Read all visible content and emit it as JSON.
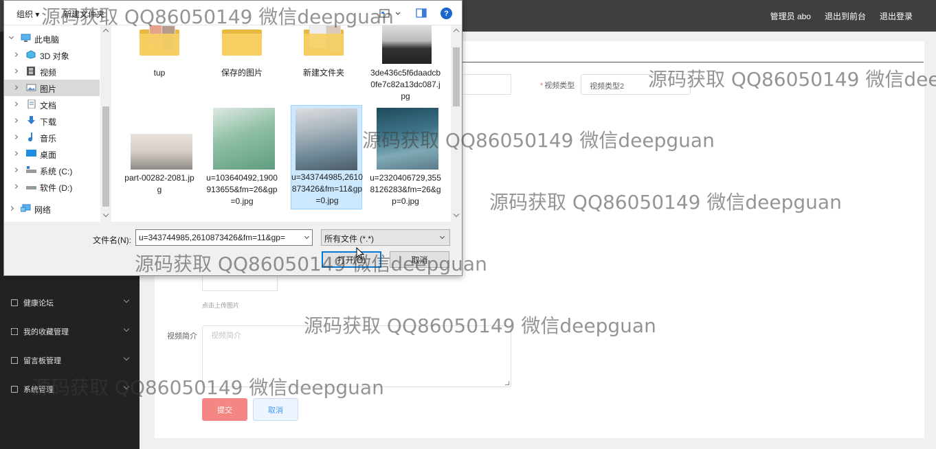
{
  "app": {
    "topbar": {
      "user_label": "管理员 abo",
      "frontend_label": "退出到前台",
      "logout_label": "退出登录"
    },
    "sidebar": [
      {
        "label": "健康论坛",
        "icon": "checkbox-icon"
      },
      {
        "label": "我的收藏管理",
        "icon": "fullscreen-icon"
      },
      {
        "label": "留言板管理",
        "icon": "monitor-icon"
      },
      {
        "label": "系统管理",
        "icon": "trash-icon"
      }
    ],
    "form": {
      "video_type_label": "视频类型",
      "video_type_value": "视频类型2",
      "upload_hint": "点击上传图片",
      "intro_label": "视频简介",
      "intro_placeholder": "视频简介",
      "submit_label": "提交",
      "cancel_label": "取消"
    }
  },
  "dialog": {
    "toolbar": {
      "organize_label": "组织 ▾",
      "new_folder_label": "新建文件夹",
      "help_label": "?"
    },
    "nav": [
      {
        "label": "此电脑",
        "icon": "computer-icon",
        "expanded": true
      },
      {
        "label": "3D 对象",
        "icon": "cube-icon"
      },
      {
        "label": "视频",
        "icon": "film-icon"
      },
      {
        "label": "图片",
        "icon": "picture-icon",
        "selected": true
      },
      {
        "label": "文档",
        "icon": "document-icon"
      },
      {
        "label": "下载",
        "icon": "download-arrow-icon"
      },
      {
        "label": "音乐",
        "icon": "music-note-icon"
      },
      {
        "label": "桌面",
        "icon": "desktop-icon"
      },
      {
        "label": "系统 (C:)",
        "icon": "system-drive-icon"
      },
      {
        "label": "软件 (D:)",
        "icon": "drive-icon"
      },
      {
        "label": "网络",
        "icon": "network-icon"
      }
    ],
    "files": [
      {
        "name": "tup",
        "kind": "folder"
      },
      {
        "name": "保存的图片",
        "kind": "folder"
      },
      {
        "name": "新建文件夹",
        "kind": "folder"
      },
      {
        "name": "3de436c5f6daadcb0fe7c82a13dc087.jpg",
        "kind": "photo"
      },
      {
        "name": "part-00282-2081.jpg",
        "kind": "photo"
      },
      {
        "name": "u=103640492,1900913655&fm=26&gp=0.jpg",
        "kind": "photo"
      },
      {
        "name": "u=343744985,2610873426&fm=11&gp=0.jpg",
        "kind": "photo",
        "selected": true
      },
      {
        "name": "u=2320406729,3558126283&fm=26&gp=0.jpg",
        "kind": "photo"
      }
    ],
    "filename_label": "文件名(N):",
    "filename_value": "u=343744985,2610873426&fm=11&gp=",
    "filter_value": "所有文件 (*.*)",
    "open_label": "打开(O)",
    "cancel_label": "取消"
  },
  "watermark": "源码获取 QQ86050149 微信deepguan",
  "colors": {
    "topbar": "#3f3f3f",
    "sidebar": "#222222",
    "submit": "#f48683",
    "selection": "#cce8ff",
    "accent": "#0078d7"
  }
}
